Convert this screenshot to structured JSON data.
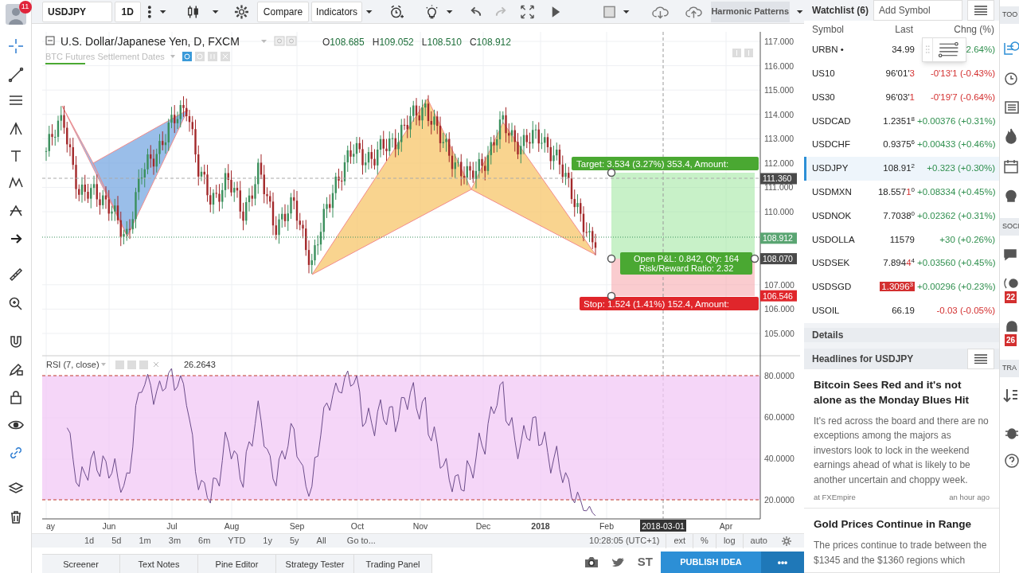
{
  "user": {
    "badge": "11"
  },
  "toolbar": {
    "symbol": "USDJPY",
    "interval": "1D",
    "compare": "Compare",
    "indicators": "Indicators",
    "template": "Harmonic Patterns"
  },
  "chart": {
    "title": "U.S. Dollar/Japanese Yen, D, FXCM",
    "ohlc": [
      {
        "label": "O",
        "value": "108.685"
      },
      {
        "label": "H",
        "value": "109.052"
      },
      {
        "label": "L",
        "value": "108.510"
      },
      {
        "label": "C",
        "value": "108.912"
      }
    ],
    "study": "BTC Futures Settlement Dates",
    "price_ticks": [
      "117.000",
      "116.000",
      "115.000",
      "114.000",
      "113.000",
      "112.000",
      "111.000",
      "110.000",
      "107.000",
      "106.000",
      "105.000"
    ],
    "price_tags": [
      {
        "kind": "crosshair",
        "label": "111.360"
      },
      {
        "kind": "last",
        "label": "108.912"
      },
      {
        "kind": "entry",
        "label": "108.070"
      },
      {
        "kind": "stop",
        "label": "106.546"
      }
    ],
    "position": {
      "target": "Target: 3.534 (3.27%) 353.4, Amount:",
      "pnl": "Open P&L: 0.842, Qty: 164",
      "ratio": "Risk/Reward Ratio: 2.32",
      "stop": "Stop: 1.524 (1.41%) 152.4, Amount:"
    },
    "time_labels": [
      {
        "label": "ay",
        "kind": "month"
      },
      {
        "label": "Jun",
        "kind": "month"
      },
      {
        "label": "Jul",
        "kind": "month"
      },
      {
        "label": "Aug",
        "kind": "month"
      },
      {
        "label": "Sep",
        "kind": "month"
      },
      {
        "label": "Oct",
        "kind": "month"
      },
      {
        "label": "Nov",
        "kind": "month"
      },
      {
        "label": "Dec",
        "kind": "month"
      },
      {
        "label": "2018",
        "kind": "year"
      },
      {
        "label": "Feb",
        "kind": "month"
      },
      {
        "label": "Apr",
        "kind": "month"
      }
    ],
    "cursor_date": "2018-03-01"
  },
  "rsi": {
    "title": "RSI (7, close)",
    "value": "26.2643",
    "ticks": [
      "80.0000",
      "60.0000",
      "40.0000",
      "20.0000"
    ]
  },
  "ranges": [
    "1d",
    "5d",
    "1m",
    "3m",
    "6m",
    "YTD",
    "1y",
    "5y",
    "All",
    "Go to..."
  ],
  "clock": "10:28:05 (UTC+1)",
  "scale_options": [
    "ext",
    "%",
    "log",
    "auto"
  ],
  "bottom_tabs": [
    "Screener",
    "Text Notes",
    "Pine Editor",
    "Strategy Tester",
    "Trading Panel"
  ],
  "share": {
    "st": "ST",
    "publish": "PUBLISH IDEA",
    "more": "•••"
  },
  "watchlist": {
    "title": "Watchlist (6)",
    "add": "Add Symbol",
    "columns": [
      "Symbol",
      "Last",
      "Chng (%)"
    ],
    "rows": [
      {
        "symbol": "URBN •",
        "last": "34.99",
        "change": "2.64%)",
        "color": "#2f8f4e",
        "selected": false,
        "flash": false
      },
      {
        "symbol": "US10",
        "last": "96'01'",
        "tick": "3",
        "change": "-0'13'1 (-0.43%)",
        "color": "#d32f2f",
        "selected": false,
        "flash": false
      },
      {
        "symbol": "US30",
        "last": "96'03'",
        "tick": "1",
        "change": "-0'19'7 (-0.64%)",
        "color": "#d32f2f",
        "selected": false,
        "flash": false
      },
      {
        "symbol": "USDCAD",
        "last": "1.2351",
        "sup": "8",
        "change": "+0.00376 (+0.31%)",
        "color": "#2f8f4e",
        "selected": false,
        "flash": false
      },
      {
        "symbol": "USDCHF",
        "last": "0.9375",
        "sup": "6",
        "change": "+0.00433 (+0.46%)",
        "color": "#2f8f4e",
        "selected": false,
        "flash": false
      },
      {
        "symbol": "USDJPY",
        "last": "108.91",
        "sup": "2",
        "change": "+0.323 (+0.30%)",
        "color": "#2f8f4e",
        "selected": true,
        "flash": false
      },
      {
        "symbol": "USDMXN",
        "last": "18.557",
        "tick": "1",
        "sup": "0",
        "change": "+0.08334 (+0.45%)",
        "color": "#2f8f4e",
        "selected": false,
        "flash": false
      },
      {
        "symbol": "USDNOK",
        "last": "7.7038",
        "sup": "0",
        "change": "+0.02362 (+0.31%)",
        "color": "#2f8f4e",
        "selected": false,
        "flash": false
      },
      {
        "symbol": "USDOLLA",
        "last": "11579",
        "change": "+30 (+0.26%)",
        "color": "#2f8f4e",
        "selected": false,
        "flash": false
      },
      {
        "symbol": "USDSEK",
        "last": "7.894",
        "tick": "4",
        "sup": "4",
        "change": "+0.03560 (+0.45%)",
        "color": "#2f8f4e",
        "selected": false,
        "flash": false
      },
      {
        "symbol": "USDSGD",
        "last": "1.3096",
        "sup": "3",
        "change": "+0.00296 (+0.23%)",
        "color": "#2f8f4e",
        "selected": false,
        "flash": true
      },
      {
        "symbol": "USOIL",
        "last": "66.19",
        "change": "-0.03 (-0.05%)",
        "color": "#d32f2f",
        "selected": false,
        "flash": false
      }
    ]
  },
  "details": "Details",
  "headlines": {
    "title": "Headlines for USDJPY",
    "items": [
      {
        "title": "Bitcoin Sees Red and it's not alone as the Monday Blues Hit",
        "body": "It's red across the board and there are no exceptions among the majors as investors look to lock in the weekend earnings ahead of what is likely to be another uncertain and choppy week.",
        "source": "at FXEmpire",
        "time": "an hour ago"
      },
      {
        "title": "Gold Prices Continue in Range",
        "body": "The prices continue to trade between the $1345 and the $1360 regions which"
      }
    ]
  },
  "side_strip": {
    "labels": [
      "TOO",
      "SOCI",
      "TRA"
    ],
    "badges": [
      "22",
      "26"
    ]
  }
}
